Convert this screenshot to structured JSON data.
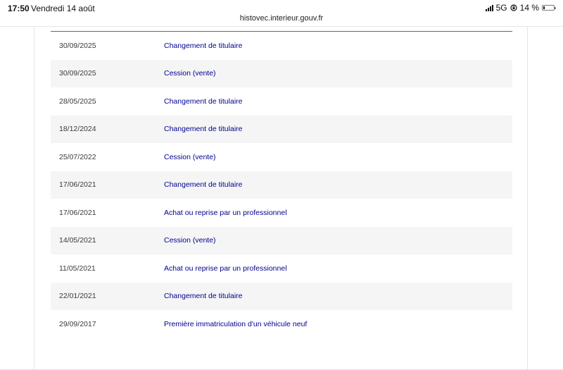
{
  "status_bar": {
    "time": "17:50",
    "date": "Vendredi 14 août",
    "network": "5G",
    "battery": "14 %",
    "battery_level": 0.14
  },
  "browser": {
    "url": "histovec.interieur.gouv.fr"
  },
  "history": {
    "rows": [
      {
        "date": "30/09/2025",
        "event": "Changement de titulaire"
      },
      {
        "date": "30/09/2025",
        "event": "Cession (vente)"
      },
      {
        "date": "28/05/2025",
        "event": "Changement de titulaire"
      },
      {
        "date": "18/12/2024",
        "event": "Changement de titulaire"
      },
      {
        "date": "25/07/2022",
        "event": "Cession (vente)"
      },
      {
        "date": "17/06/2021",
        "event": "Changement de titulaire"
      },
      {
        "date": "17/06/2021",
        "event": "Achat ou reprise par un professionnel"
      },
      {
        "date": "14/05/2021",
        "event": "Cession (vente)"
      },
      {
        "date": "11/05/2021",
        "event": "Achat ou reprise par un professionnel"
      },
      {
        "date": "22/01/2021",
        "event": "Changement de titulaire"
      },
      {
        "date": "29/09/2017",
        "event": "Première immatriculation d'un véhicule neuf"
      }
    ]
  }
}
